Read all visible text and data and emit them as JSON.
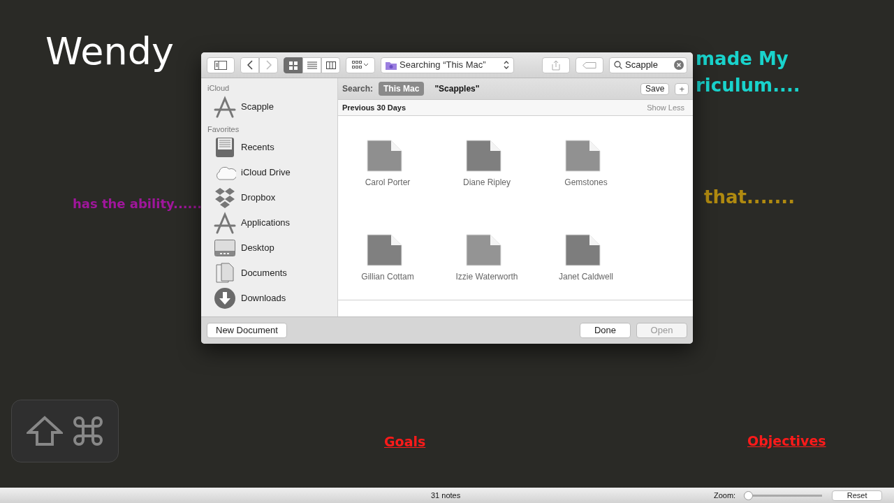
{
  "canvas": {
    "notes": [
      {
        "text": "Wendy",
        "color": "#ffffff",
        "kind": "title"
      },
      {
        "text": "made My",
        "color": "#19d3cc",
        "kind": "note"
      },
      {
        "text": "riculum....",
        "color": "#19d3cc",
        "kind": "note"
      },
      {
        "text": "has the ability......",
        "color": "#a0169c",
        "kind": "small"
      },
      {
        "text": "that.......",
        "color": "#b08a10",
        "kind": "note"
      },
      {
        "text": "Goals",
        "color": "#ff1a1a",
        "kind": "link"
      },
      {
        "text": "Objectives",
        "color": "#ff1a1a",
        "kind": "link"
      }
    ]
  },
  "dialog": {
    "toolbar": {
      "nav_buttons": [
        {
          "disabled": false
        },
        {
          "disabled": true
        }
      ],
      "view_modes": [
        {
          "selected": true
        },
        {
          "selected": false
        },
        {
          "selected": false
        }
      ],
      "location": "Searching “This Mac”",
      "search": {
        "value": "Scapple"
      }
    },
    "sidebar": [
      {
        "heading": "iCloud",
        "items": [
          {
            "label": "Scapple",
            "kind": "app"
          }
        ]
      },
      {
        "heading": "Favorites",
        "items": [
          {
            "label": "Recents",
            "kind": "recents"
          },
          {
            "label": "iCloud Drive",
            "kind": "cloud"
          },
          {
            "label": "Dropbox",
            "kind": "dropbox"
          },
          {
            "label": "Applications",
            "kind": "app"
          },
          {
            "label": "Desktop",
            "kind": "desktop"
          },
          {
            "label": "Documents",
            "kind": "documents"
          },
          {
            "label": "Downloads",
            "kind": "downloads"
          }
        ]
      }
    ],
    "scope_bar": {
      "label": "Search:",
      "scopes": [
        {
          "text": "This Mac",
          "selected": true
        },
        {
          "text": "\"Scapples\"",
          "selected": false
        }
      ],
      "save": "Save",
      "add": "+"
    },
    "section": {
      "title": "Previous 30 Days",
      "toggle": "Show Less"
    },
    "files": [
      {
        "name": "Carol Porter"
      },
      {
        "name": "Diane Ripley"
      },
      {
        "name": "Gemstones"
      },
      {
        "name": "Gillian Cottam"
      },
      {
        "name": "Izzie Waterworth"
      },
      {
        "name": "Janet Caldwell"
      }
    ],
    "footer": {
      "new_button": "New Document",
      "buttons": [
        {
          "label": "Done",
          "disabled": false
        },
        {
          "label": "Open",
          "disabled": true
        }
      ]
    }
  },
  "status_bar": {
    "count": "31 notes",
    "zoom_label": "Zoom:",
    "zoom": {
      "level": 0
    },
    "reset": "Reset"
  }
}
